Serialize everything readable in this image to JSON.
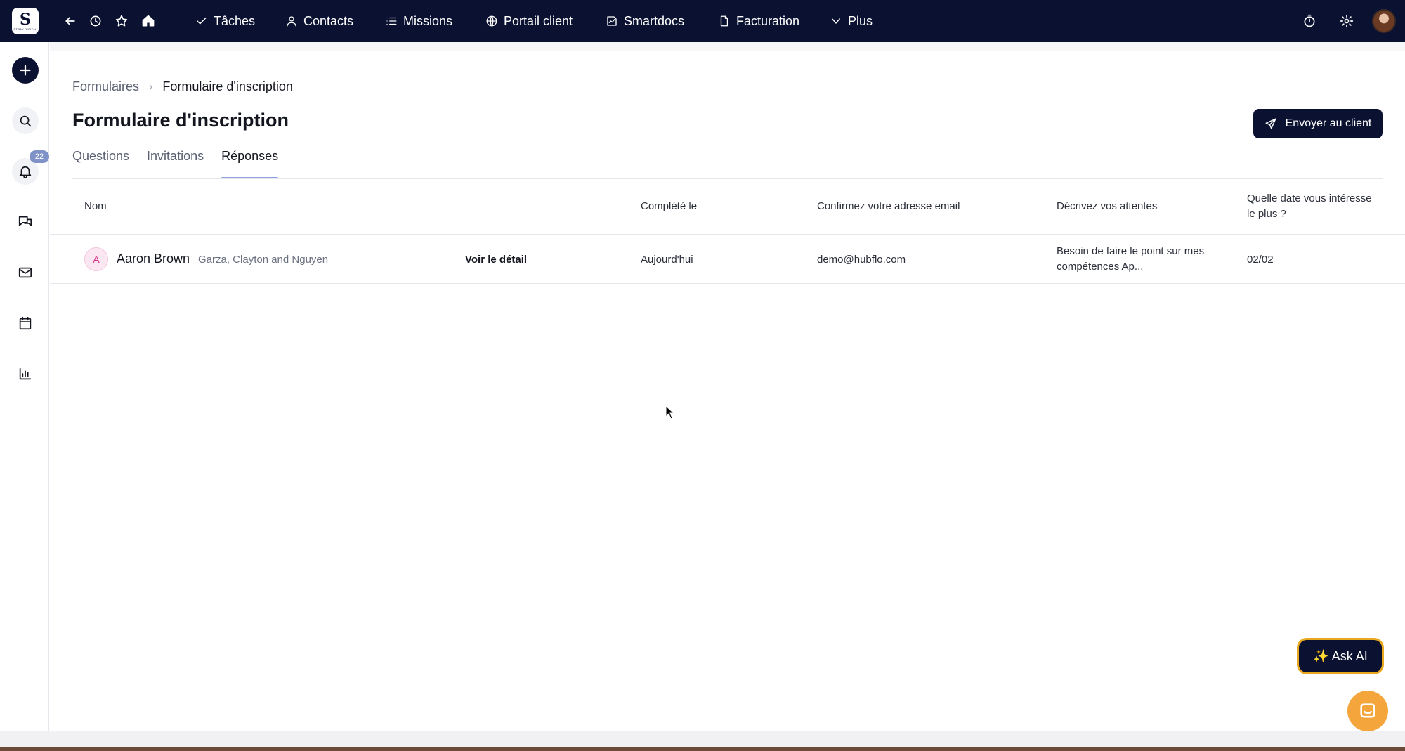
{
  "brand": {
    "logo_mark": "S",
    "logo_text": "STRAY DIGITAL"
  },
  "topnav": {
    "items": [
      {
        "label": "Tâches",
        "icon": "check-icon"
      },
      {
        "label": "Contacts",
        "icon": "person-icon"
      },
      {
        "label": "Missions",
        "icon": "list-icon"
      },
      {
        "label": "Portail client",
        "icon": "globe-icon"
      },
      {
        "label": "Smartdocs",
        "icon": "chart-doc-icon"
      },
      {
        "label": "Facturation",
        "icon": "file-icon"
      },
      {
        "label": "Plus",
        "icon": "chevron-down-icon"
      }
    ]
  },
  "sidebar": {
    "notifications_count": "22"
  },
  "breadcrumb": {
    "parent": "Formulaires",
    "separator": "›",
    "current": "Formulaire d'inscription"
  },
  "page": {
    "title": "Formulaire d'inscription",
    "send_button": "Envoyer au client"
  },
  "tabs": [
    {
      "label": "Questions",
      "active": false
    },
    {
      "label": "Invitations",
      "active": false
    },
    {
      "label": "Réponses",
      "active": true
    }
  ],
  "table": {
    "headers": {
      "name": "Nom",
      "completed": "Complété le",
      "email": "Confirmez votre adresse email",
      "expectations": "Décrivez vos attentes",
      "date_question": "Quelle date vous intéresse le plus ?"
    },
    "rows": [
      {
        "avatar_letter": "A",
        "name": "Aaron Brown",
        "company": "Garza, Clayton and Nguyen",
        "detail_link": "Voir le détail",
        "completed": "Aujourd'hui",
        "email": "demo@hubflo.com",
        "expectations": "Besoin de faire le point sur mes compétences Ap...",
        "date_answer": "02/02"
      }
    ]
  },
  "ask_ai": {
    "label": "✨ Ask AI"
  },
  "colors": {
    "topbar": "#0b1131",
    "tab_indicator": "#8ea3dc",
    "ask_ai_border": "#e8a820",
    "chat_fab": "#f4a53c",
    "badge": "#7f93c8"
  }
}
